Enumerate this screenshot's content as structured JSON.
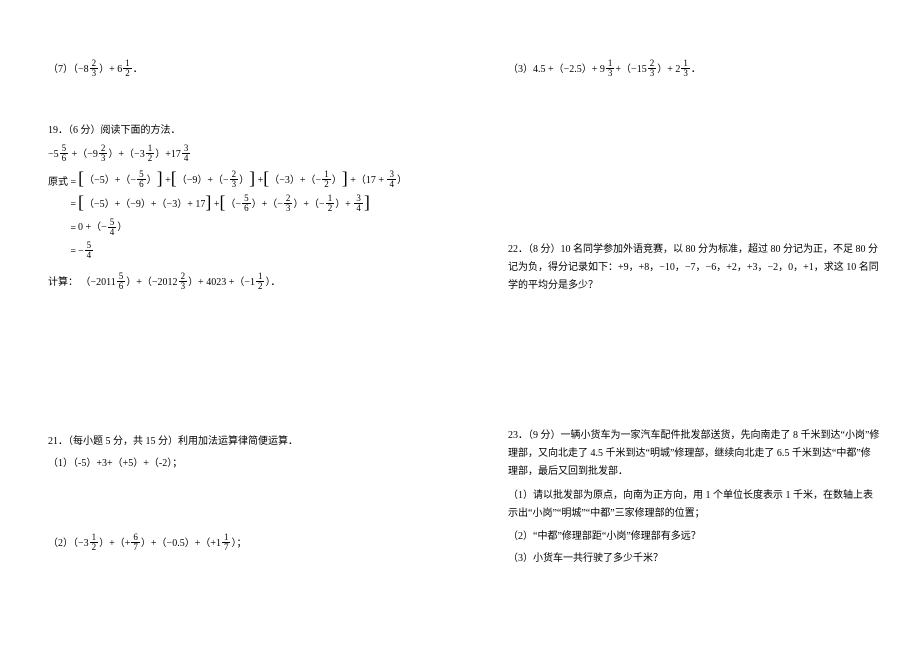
{
  "left": {
    "q7": "（7）（−8⅔）+ 6½ ．",
    "q19_head": "19．（6 分）阅读下面的方法．",
    "q19_expr": "−5⅚ +（−9⅔）+（−3½）+17¾",
    "q19_step_label": "原式 =",
    "q19_s1": "[（−5）+（−⅚）] + [（−9）+（−⅔）] + [（−3）+（−½）] +（17 + ¾）",
    "q19_s2": "= [（−5）+（−9）+（−3）+ 17] + [（−⅚）+（−⅔）+（−½）+ ¾]",
    "q19_s3": "= 0 +（−5/4）",
    "q19_s4": "= −5/4",
    "q19_calc": "计算：（−2011⅚）+（−2012⅔）+ 4023 +（−1½）．",
    "q21_head": "21．（每小题 5 分，共 15 分）利用加法运算律简便运算．",
    "q21_1": "（1）（-5）+3+（+5）+（-2）；",
    "q21_2": "（2）（−3½）+（+ 6/7）+（−0.5）+（+1 1/7）；"
  },
  "right": {
    "q3": "（3）4.5 +（−2.5）+ 9⅓ +（−15⅔）+ 2⅓ ．",
    "q22": "22．（8 分）10 名同学参加外语竞赛，以 80 分为标准，超过 80 分记为正，不足 80 分记为负，得分记录如下：+9，+8，−10，−7，−6，+2，+3，−2，0，+1，求这 10 名同学的平均分是多少？",
    "q23_head": "23．（9 分）一辆小货车为一家汽车配件批发部送货，先向南走了 8 千米到达“小岗”修理部，又向北走了 4.5 千米到达“明城”修理部，继续向北走了 6.5 千米到达“中都”修理部，最后又回到批发部．",
    "q23_1": "（1）请以批发部为原点，向南为正方向，用 1 个单位长度表示 1 千米，在数轴上表示出“小岗”“明城”“中都”三家修理部的位置；",
    "q23_2": "（2）“中都”修理部距“小岗”修理部有多远？",
    "q23_3": "（3）小货车一共行驶了多少千米？"
  }
}
